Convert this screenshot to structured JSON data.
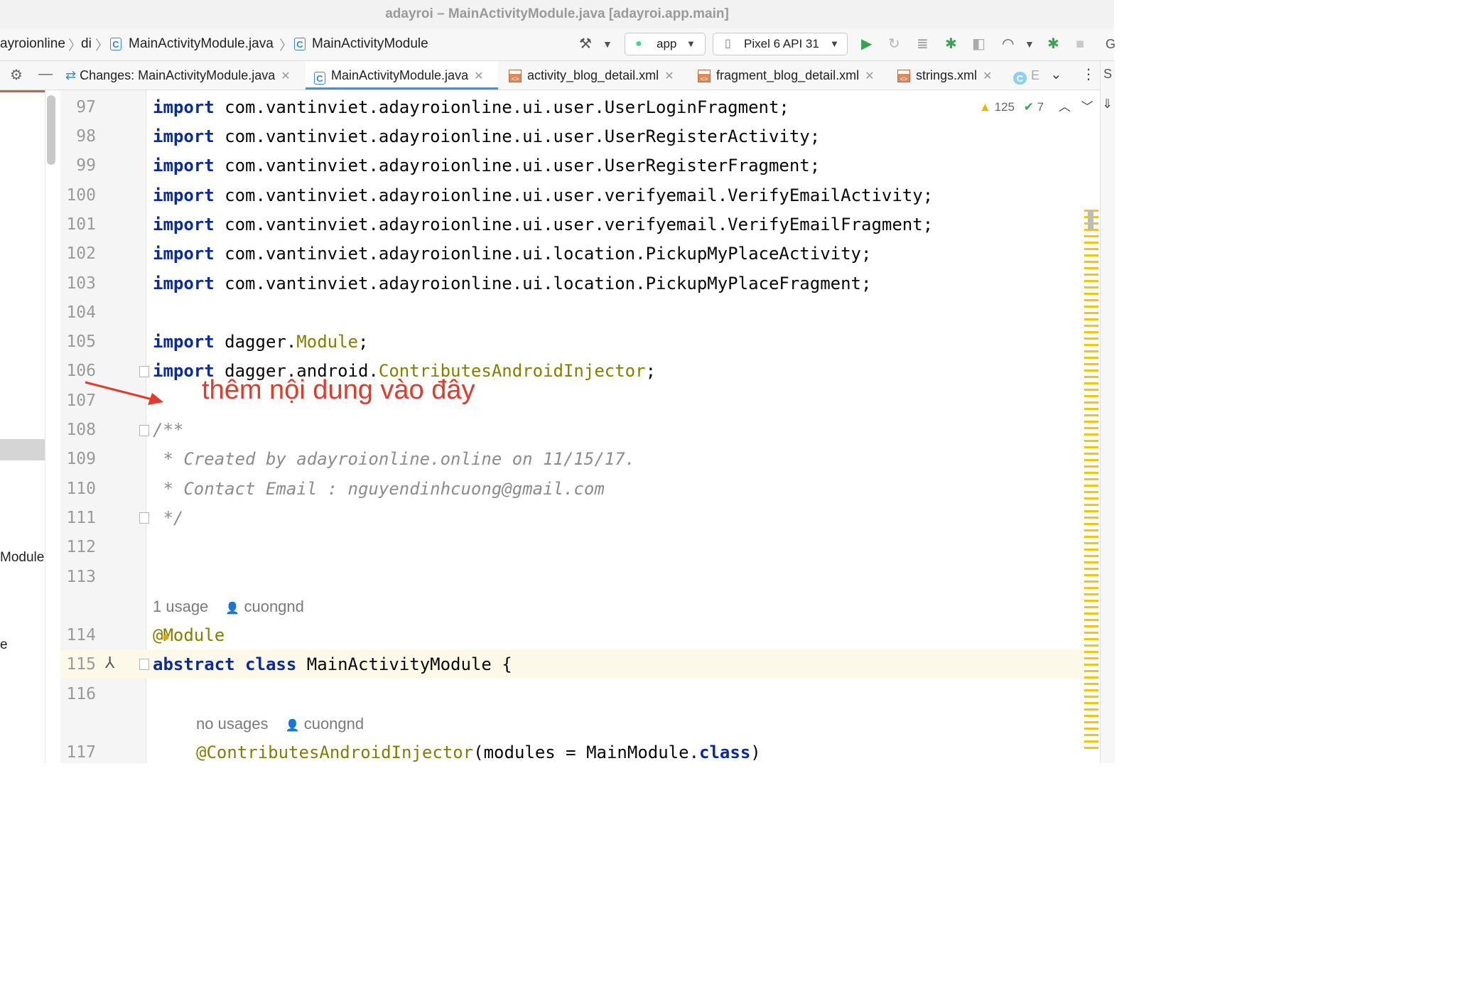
{
  "window": {
    "title": "adayroi – MainActivityModule.java [adayroi.app.main]"
  },
  "breadcrumb": {
    "items": [
      "ayroionline",
      "di",
      "MainActivityModule.java",
      "MainActivityModule"
    ]
  },
  "toolbar": {
    "run_config": "app",
    "device": "Pixel 6 API 31"
  },
  "tabs": [
    {
      "label": "Changes: MainActivityModule.java",
      "icon": "diff-icon"
    },
    {
      "label": "MainActivityModule.java",
      "icon": "class-icon",
      "active": true
    },
    {
      "label": "activity_blog_detail.xml",
      "icon": "xml-icon"
    },
    {
      "label": "fragment_blog_detail.xml",
      "icon": "xml-icon"
    },
    {
      "label": "strings.xml",
      "icon": "xml-icon"
    },
    {
      "label": "E",
      "icon": "class-icon"
    }
  ],
  "inspections": {
    "warnings": "125",
    "ok": "7"
  },
  "left_panel": {
    "module_label": "Module",
    "partial": "e"
  },
  "editor": {
    "lines": [
      {
        "num": "97",
        "kw": "import",
        "rest": " com.vantinviet.adayroionline.ui.user.UserLoginFragment;"
      },
      {
        "num": "98",
        "kw": "import",
        "rest": " com.vantinviet.adayroionline.ui.user.UserRegisterActivity;"
      },
      {
        "num": "99",
        "kw": "import",
        "rest": " com.vantinviet.adayroionline.ui.user.UserRegisterFragment;"
      },
      {
        "num": "100",
        "kw": "import",
        "rest": " com.vantinviet.adayroionline.ui.user.verifyemail.VerifyEmailActivity;"
      },
      {
        "num": "101",
        "kw": "import",
        "rest": " com.vantinviet.adayroionline.ui.user.verifyemail.VerifyEmailFragment;"
      },
      {
        "num": "102",
        "kw": "import",
        "rest": " com.vantinviet.adayroionline.ui.location.PickupMyPlaceActivity;"
      },
      {
        "num": "103",
        "kw": "import",
        "rest": " com.vantinviet.adayroionline.ui.location.PickupMyPlaceFragment;"
      },
      {
        "num": "104"
      },
      {
        "num": "105",
        "kw": "import",
        "rest": " dagger.",
        "ann": "Module",
        "tail": ";"
      },
      {
        "num": "106",
        "kw": "import",
        "rest": " dagger.android.",
        "ann": "ContributesAndroidInjector",
        "tail": ";"
      },
      {
        "num": "107"
      },
      {
        "num": "108",
        "comment": "/**"
      },
      {
        "num": "109",
        "comment": " * Created by adayroionline.online on 11/15/17."
      },
      {
        "num": "110",
        "comment": " * Contact Email : nguyendinhcuong@gmail.com"
      },
      {
        "num": "111",
        "comment": " */"
      },
      {
        "num": "112"
      },
      {
        "num": "113"
      },
      {
        "num": "114",
        "ann": "@Module"
      },
      {
        "num": "115",
        "kw": "abstract class",
        "rest": " MainActivityModule {"
      },
      {
        "num": "116"
      },
      {
        "num": "117",
        "ann": "@ContributesAndroidInjector",
        "rest": "(modules = MainModule.",
        "kw2": "class",
        "tail": ")"
      }
    ],
    "hint1": {
      "usages": "1 usage",
      "author": "cuongnd"
    },
    "hint2": {
      "usages": "no usages",
      "author": "cuongnd"
    }
  },
  "annotation": {
    "text": "thêm nội dung vào đây",
    "color": "#e23a2b"
  }
}
